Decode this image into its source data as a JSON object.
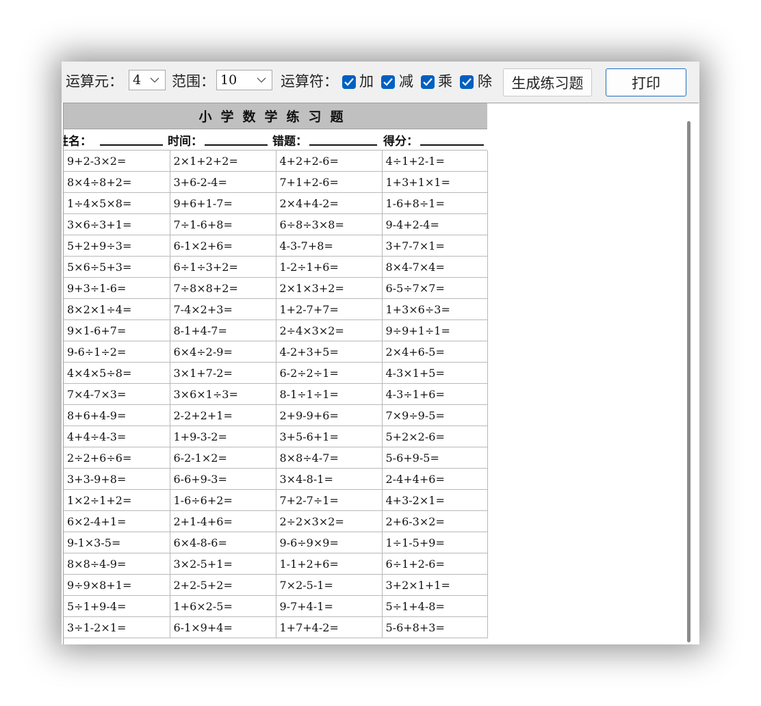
{
  "toolbar": {
    "operand_label": "运算元：",
    "operand_value": "4",
    "range_label": "范围：",
    "range_value": "10",
    "operator_label": "运算符：",
    "operators": [
      {
        "label": "加",
        "checked": true
      },
      {
        "label": "减",
        "checked": true
      },
      {
        "label": "乘",
        "checked": true
      },
      {
        "label": "除",
        "checked": true
      }
    ],
    "generate_label": "生成练习题",
    "print_label": "打印"
  },
  "sheet": {
    "title": "小学数学练习题",
    "name_label": "姓名：",
    "time_label": "时间：",
    "errors_label": "错题：",
    "score_label": "得分："
  },
  "problems": [
    [
      "9+2-3×2=",
      "2×1+2+2=",
      "4+2+2-6=",
      "4÷1+2-1="
    ],
    [
      "8×4÷8+2=",
      "3+6-2-4=",
      "7+1+2-6=",
      "1+3+1×1="
    ],
    [
      "1÷4×5×8=",
      "9+6+1-7=",
      "2×4+4-2=",
      "1-6+8÷1="
    ],
    [
      "3×6÷3+1=",
      "7÷1-6+8=",
      "6÷8÷3×8=",
      "9-4+2-4="
    ],
    [
      "5+2+9÷3=",
      "6-1×2+6=",
      "4-3-7+8=",
      "3+7-7×1="
    ],
    [
      "5×6÷5+3=",
      "6÷1÷3+2=",
      "1-2÷1+6=",
      "8×4-7×4="
    ],
    [
      "9+3÷1-6=",
      "7÷8×8+2=",
      "2×1×3+2=",
      "6-5÷7×7="
    ],
    [
      "8×2×1÷4=",
      "7-4×2+3=",
      "1+2-7+7=",
      "1+3×6÷3="
    ],
    [
      "9×1-6+7=",
      "8-1+4-7=",
      "2÷4×3×2=",
      "9÷9+1÷1="
    ],
    [
      "9-6÷1÷2=",
      "6×4÷2-9=",
      "4-2+3+5=",
      "2×4+6-5="
    ],
    [
      "4×4×5÷8=",
      "3×1+7-2=",
      "6-2÷2÷1=",
      "4-3×1+5="
    ],
    [
      "7×4-7×3=",
      "3×6×1÷3=",
      "8-1÷1÷1=",
      "4-3÷1+6="
    ],
    [
      "8+6+4-9=",
      "2-2+2+1=",
      "2+9-9+6=",
      "7×9÷9-5="
    ],
    [
      "4+4÷4-3=",
      "1+9-3-2=",
      "3+5-6+1=",
      "5+2×2-6="
    ],
    [
      "2÷2+6÷6=",
      "6-2-1×2=",
      "8×8÷4-7=",
      "5-6+9-5="
    ],
    [
      "3+3-9+8=",
      "6-6+9-3=",
      "3×4-8-1=",
      "2-4+4+6="
    ],
    [
      "1×2÷1+2=",
      "1-6÷6+2=",
      "7+2-7÷1=",
      "4+3-2×1="
    ],
    [
      "6×2-4+1=",
      "2+1-4+6=",
      "2÷2×3×2=",
      "2+6-3×2="
    ],
    [
      "9-1×3-5=",
      "6×4-8-6=",
      "9-6÷9×9=",
      "1÷1-5+9="
    ],
    [
      "8×8÷4-9=",
      "3×2-5+1=",
      "1-1+2+6=",
      "6÷1+2-6="
    ],
    [
      "9÷9×8+1=",
      "2+2-5+2=",
      "7×2-5-1=",
      "3+2×1+1="
    ],
    [
      "5÷1+9-4=",
      "1+6×2-5=",
      "9-7+4-1=",
      "5÷1+4-8="
    ],
    [
      "3÷1-2×1=",
      "6-1×9+4=",
      "1+7+4-2=",
      "5-6+8+3="
    ]
  ]
}
